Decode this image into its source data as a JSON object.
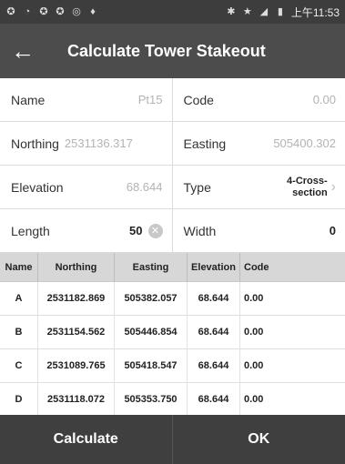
{
  "status_bar": {
    "time": "上午11:53"
  },
  "app_bar": {
    "back_icon": "arrow-left-icon",
    "title": "Calculate Tower Stakeout"
  },
  "form": {
    "name_label": "Name",
    "name_value": "Pt15",
    "code_label": "Code",
    "code_value": "0.00",
    "northing_label": "Northing",
    "northing_value": "2531136.317",
    "easting_label": "Easting",
    "easting_value": "505400.302",
    "elevation_label": "Elevation",
    "elevation_value": "68.644",
    "type_label": "Type",
    "type_value": "4-Cross-section",
    "length_label": "Length",
    "length_value": "50",
    "width_label": "Width",
    "width_value": "0"
  },
  "table": {
    "headers": [
      "Name",
      "Northing",
      "Easting",
      "Elevation",
      "Code"
    ],
    "rows": [
      [
        "A",
        "2531182.869",
        "505382.057",
        "68.644",
        "0.00"
      ],
      [
        "B",
        "2531154.562",
        "505446.854",
        "68.644",
        "0.00"
      ],
      [
        "C",
        "2531089.765",
        "505418.547",
        "68.644",
        "0.00"
      ],
      [
        "D",
        "2531118.072",
        "505353.750",
        "68.644",
        "0.00"
      ]
    ]
  },
  "buttons": {
    "calculate": "Calculate",
    "ok": "OK"
  }
}
